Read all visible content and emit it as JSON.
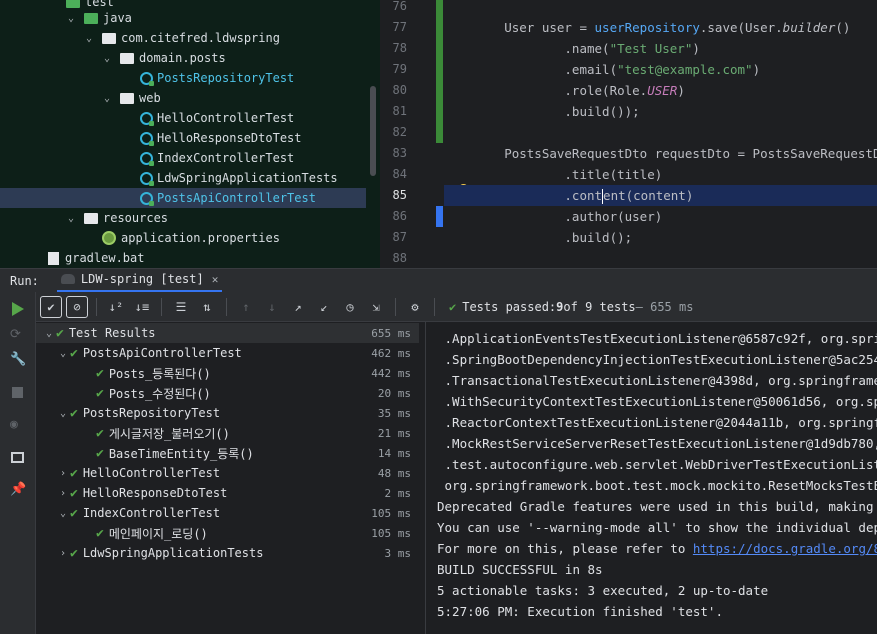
{
  "tree": {
    "items": [
      {
        "label": "test",
        "type": "folder-green"
      },
      {
        "label": "java",
        "type": "folder-green"
      },
      {
        "label": "com.citefred.ldwspring",
        "type": "package"
      },
      {
        "label": "domain.posts",
        "type": "package"
      },
      {
        "label": "PostsRepositoryTest",
        "type": "test-class"
      },
      {
        "label": "web",
        "type": "package"
      },
      {
        "label": "HelloControllerTest",
        "type": "test-class"
      },
      {
        "label": "HelloResponseDtoTest",
        "type": "test-class"
      },
      {
        "label": "IndexControllerTest",
        "type": "test-class"
      },
      {
        "label": "LdwSpringApplicationTests",
        "type": "test-class"
      },
      {
        "label": "PostsApiControllerTest",
        "type": "test-class"
      },
      {
        "label": "resources",
        "type": "folder"
      },
      {
        "label": "application.properties",
        "type": "properties"
      },
      {
        "label": "gradlew.bat",
        "type": "file"
      }
    ]
  },
  "editor": {
    "line_numbers": [
      "76",
      "77",
      "78",
      "79",
      "80",
      "81",
      "82",
      "83",
      "84",
      "85",
      "86",
      "87",
      "88"
    ],
    "current_line": "85"
  },
  "run": {
    "label": "Run:",
    "tab_label": "LDW-spring [test]"
  },
  "toolbar": {
    "status_prefix": "Tests passed: ",
    "passed": "9",
    "of_text": " of 9 tests",
    "duration": " – 655 ms"
  },
  "results": {
    "items": [
      {
        "label": "Test Results",
        "time": "655 ms"
      },
      {
        "label": "PostsApiControllerTest",
        "time": "462 ms"
      },
      {
        "label": "Posts_등록된다()",
        "time": "442 ms"
      },
      {
        "label": "Posts_수정된다()",
        "time": "20 ms"
      },
      {
        "label": "PostsRepositoryTest",
        "time": "35 ms"
      },
      {
        "label": "게시글저장_불러오기()",
        "time": "21 ms"
      },
      {
        "label": "BaseTimeEntity_등록()",
        "time": "14 ms"
      },
      {
        "label": "HelloControllerTest",
        "time": "48 ms"
      },
      {
        "label": "HelloResponseDtoTest",
        "time": "2 ms"
      },
      {
        "label": "IndexControllerTest",
        "time": "105 ms"
      },
      {
        "label": "메인페이지_로딩()",
        "time": "105 ms"
      },
      {
        "label": "LdwSpringApplicationTests",
        "time": "3 ms"
      }
    ]
  },
  "console": {
    "lines": [
      " .ApplicationEventsTestExecutionListener@6587c92f, org.springfr",
      " .SpringBootDependencyInjectionTestExecutionListener@5ac25491,",
      " .TransactionalTestExecutionListener@4398d, org.springframework",
      " .WithSecurityContextTestExecutionListener@50061d56, org.spring",
      " .ReactorContextTestExecutionListener@2044a11b, org.springframe",
      " .MockRestServiceServerResetTestExecutionListener@1d9db780, org",
      " .test.autoconfigure.web.servlet.WebDriverTestExecutionListener",
      " org.springframework.boot.test.mock.mockito.ResetMocksTestExecu",
      "Deprecated Gradle features were used in this build, making it i",
      "You can use '--warning-mode all' to show the individual depreca",
      "For more on this, please refer to ",
      "BUILD SUCCESSFUL in 8s",
      "5 actionable tasks: 3 executed, 2 up-to-date",
      "5:27:06 PM: Execution finished 'test'."
    ],
    "link_text": "https://docs.gradle.org/8.5/u"
  },
  "colors": {
    "pass_green": "#57a64a",
    "accent_blue": "#3574f0",
    "test_cyan": "#4fc3e8"
  }
}
